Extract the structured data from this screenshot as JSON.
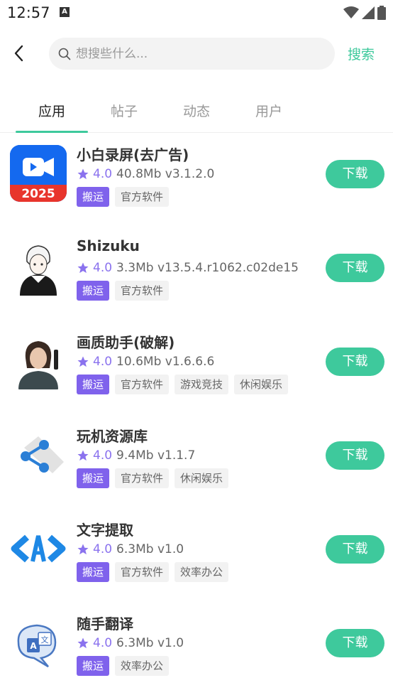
{
  "status": {
    "time": "12:57",
    "notif_letter": "A"
  },
  "header": {
    "search_placeholder": "想搜些什么...",
    "search_label": "搜索"
  },
  "tabs": [
    {
      "label": "应用",
      "active": true
    },
    {
      "label": "帖子",
      "active": false
    },
    {
      "label": "动态",
      "active": false
    },
    {
      "label": "用户",
      "active": false
    }
  ],
  "apps": [
    {
      "name": "小白录屏(去广告)",
      "rating": "4.0",
      "meta": "40.8Mb v3.1.2.0",
      "icon": "video-camera-icon",
      "icon_text": "2025",
      "tags": [
        "搬运",
        "官方软件"
      ],
      "button": "下载"
    },
    {
      "name": "Shizuku",
      "rating": "4.0",
      "meta": "3.3Mb v13.5.4.r1062.c02de15",
      "icon": "anime-character-icon",
      "tags": [
        "搬运",
        "官方软件"
      ],
      "button": "下载"
    },
    {
      "name": "画质助手(破解)",
      "rating": "4.0",
      "meta": "10.6Mb v1.6.6.6",
      "icon": "game-character-icon",
      "tags": [
        "搬运",
        "官方软件",
        "游戏竞技",
        "休闲娱乐"
      ],
      "button": "下载"
    },
    {
      "name": "玩机资源库",
      "rating": "4.0",
      "meta": "9.4Mb v1.1.7",
      "icon": "share-icon",
      "tags": [
        "搬运",
        "官方软件",
        "休闲娱乐"
      ],
      "button": "下载"
    },
    {
      "name": "文字提取",
      "rating": "4.0",
      "meta": "6.3Mb v1.0",
      "icon": "code-brackets-icon",
      "tags": [
        "搬运",
        "官方软件",
        "效率办公"
      ],
      "button": "下载"
    },
    {
      "name": "随手翻译",
      "rating": "4.0",
      "meta": "6.3Mb v1.0",
      "icon": "translate-icon",
      "icon_text_a": "A",
      "icon_text_b": "文",
      "tags": [
        "搬运",
        "效率办公"
      ],
      "button": "下载"
    }
  ],
  "colors": {
    "accent": "#3ec99c",
    "tag_primary": "#7f62ec",
    "star": "#8a72ee"
  }
}
